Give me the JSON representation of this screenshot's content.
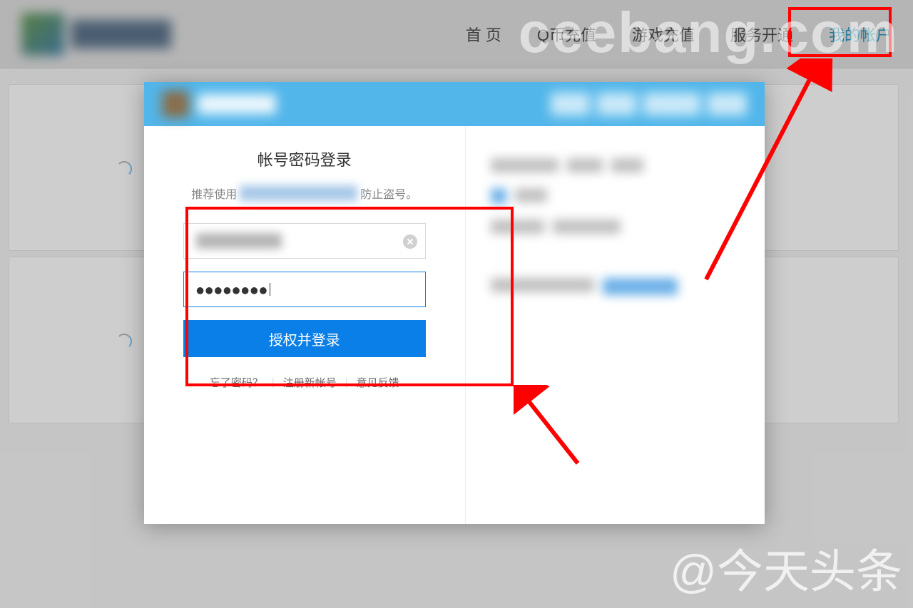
{
  "nav": {
    "home": "首 页",
    "qcoin": "Q币充值",
    "game": "游戏充值",
    "service": "服务开通",
    "account": "我的帐户"
  },
  "login": {
    "title": "帐号密码登录",
    "subtitle_pre": "推荐使用",
    "subtitle_post": "防止盗号。",
    "password_mask": "●●●●●●●●",
    "button": "授权并登录",
    "forgot": "忘了密码？",
    "register": "注册新帐号",
    "feedback": "意见反馈"
  },
  "watermark": {
    "top": "ceebang.com",
    "bottom": "@今天头条"
  }
}
